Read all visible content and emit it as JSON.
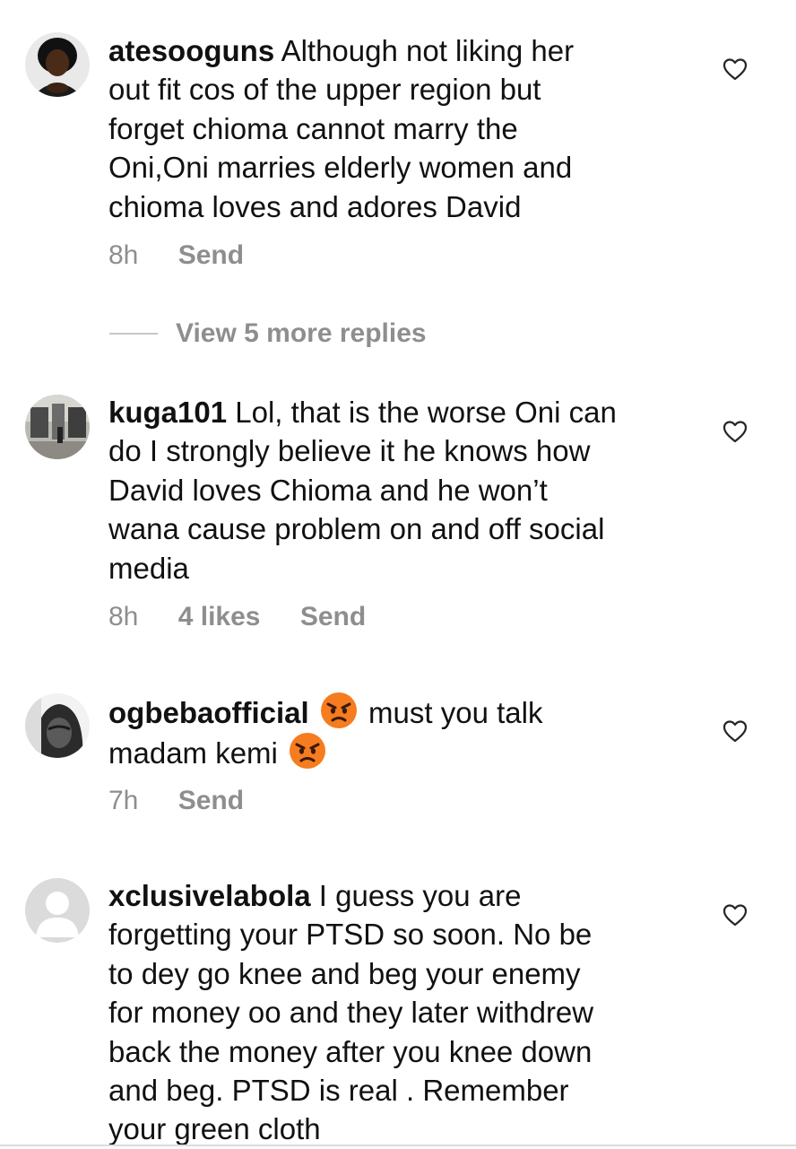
{
  "comments": [
    {
      "username": "atesooguns",
      "lines": [
        "Although not liking her",
        "out fit cos of the upper region but",
        "forget chioma cannot marry the",
        "Oni,Oni marries elderly women and",
        "chioma loves and adores David"
      ],
      "time": "8h",
      "send": "Send",
      "avatar_icon": "profile-photo-woman"
    },
    {
      "username": "kuga101",
      "lines": [
        "Lol, that is the worse Oni can",
        "do I strongly believe it he knows how",
        "David loves Chioma and he won’t",
        "wana cause problem on and off social",
        "media"
      ],
      "time": "8h",
      "likes": "4 likes",
      "send": "Send",
      "avatar_icon": "profile-photo-storefront"
    },
    {
      "username": "ogbebaofficial",
      "line1_text": "must you talk",
      "line2_text": "madam kemi",
      "emoji": "angry-face",
      "time": "7h",
      "send": "Send",
      "avatar_icon": "profile-photo-hooded-person"
    },
    {
      "username": "xclusivelabola",
      "lines": [
        "I guess you are",
        "forgetting your PTSD so soon. No be",
        "to dey go knee and beg your enemy",
        "for money oo and they later withdrew",
        "back the money after you knee down",
        "and beg. PTSD  is real . Remember",
        "your green cloth"
      ],
      "avatar_icon": "default-avatar"
    }
  ],
  "view_replies": "View 5 more replies",
  "colors": {
    "text": "#111111",
    "meta": "#8e8e8e",
    "divider": "#c7c7c7",
    "emoji": "#f57c1f"
  }
}
